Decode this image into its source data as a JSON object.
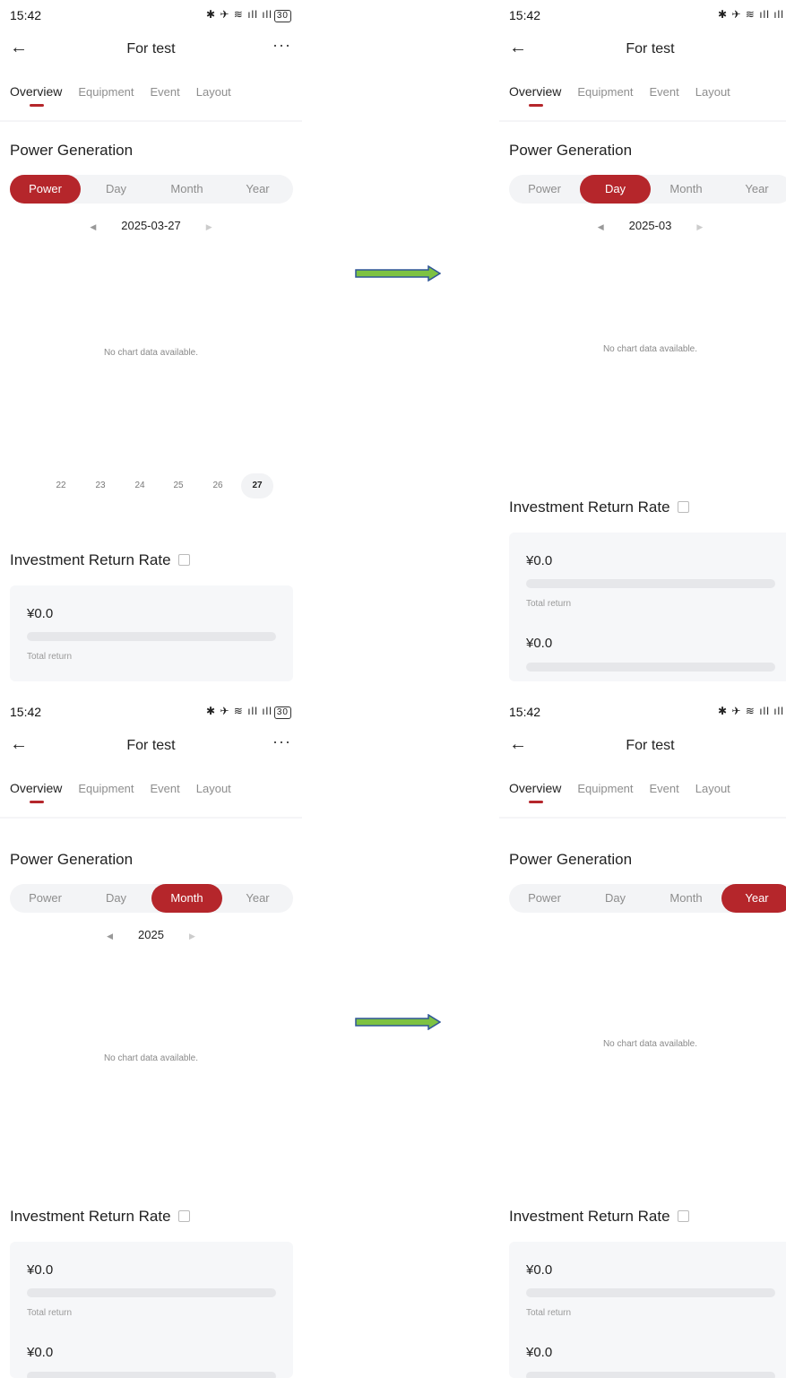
{
  "status": {
    "time": "15:42",
    "battery": "30"
  },
  "header": {
    "title": "For test",
    "back": "←",
    "more": "···"
  },
  "tabs": [
    "Overview",
    "Equipment",
    "Event",
    "Layout"
  ],
  "power": {
    "title": "Power Generation",
    "segments": [
      "Power",
      "Day",
      "Month",
      "Year"
    ]
  },
  "screens": [
    {
      "active_segment": "Power",
      "date": "2025-03-27"
    },
    {
      "active_segment": "Day",
      "date": "2025-03"
    },
    {
      "active_segment": "Month",
      "date": "2025"
    },
    {
      "active_segment": "Year",
      "date": ""
    }
  ],
  "days": [
    "22",
    "23",
    "24",
    "25",
    "26",
    "27"
  ],
  "active_day": "27",
  "no_data": "No chart data available.",
  "investment": {
    "title": "Investment Return Rate",
    "amount": "¥0.0",
    "total_label": "Total return",
    "amount2": "¥0.0"
  },
  "colors": {
    "accent": "#b5262b",
    "arrow_fill": "#7dc242",
    "arrow_border": "#2f5597"
  }
}
